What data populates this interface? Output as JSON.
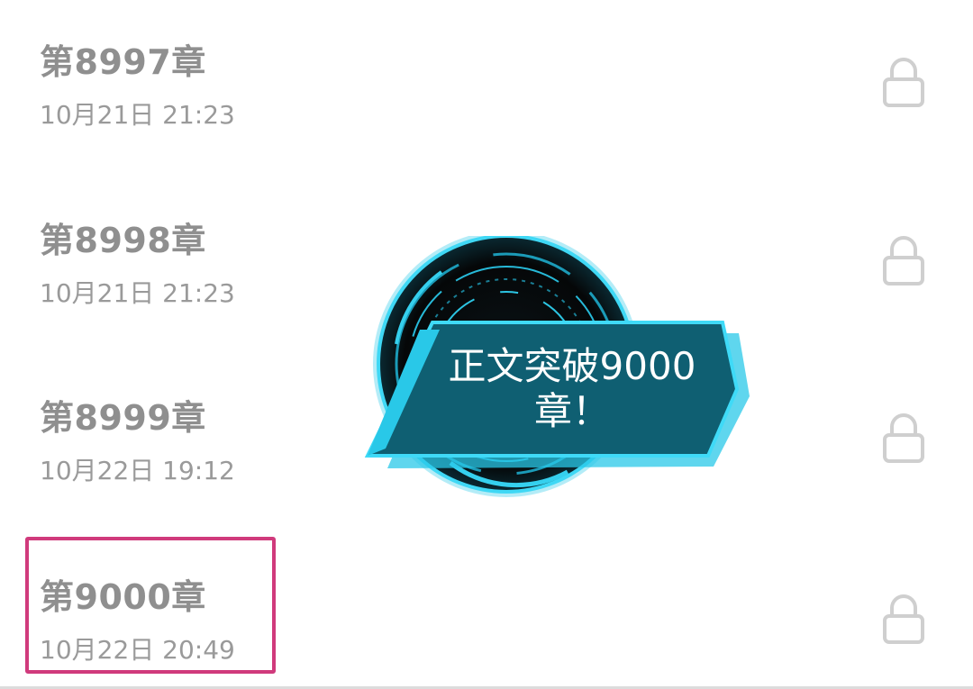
{
  "chapters": [
    {
      "title": "第8997章",
      "time": "10月21日 21:23"
    },
    {
      "title": "第8998章",
      "time": "10月21日 21:23"
    },
    {
      "title": "第8999章",
      "time": "10月22日 19:12"
    },
    {
      "title": "第9000章",
      "time": "10月22日 20:49"
    }
  ],
  "milestone": {
    "line1": "正文突破9000",
    "line2": "章！"
  },
  "icons": {
    "lock": "lock-icon"
  },
  "colors": {
    "highlight_border": "#d03a7c",
    "badge_cyan": "#29c8e8",
    "badge_teal": "#0f5f72"
  }
}
